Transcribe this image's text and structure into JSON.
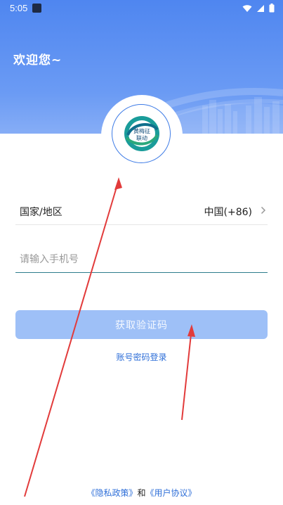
{
  "status_bar": {
    "time": "5:05"
  },
  "header": {
    "greeting": "欢迎您~"
  },
  "logo": {
    "text_line1": "黄梅征",
    "text_line2": "联动"
  },
  "country_row": {
    "label": "国家/地区",
    "value": "中国(+86)"
  },
  "phone": {
    "placeholder": "请输入手机号",
    "value": ""
  },
  "code_button": {
    "label": "获取验证码"
  },
  "password_login": {
    "label": "账号密码登录"
  },
  "footer": {
    "privacy": "《隐私政策》",
    "conj": "和",
    "terms": "《用户协议》"
  },
  "colors": {
    "header": "#5b8ff2",
    "button": "#9ec0f7",
    "link": "#2f6fd8",
    "annotation": "#e23b3b"
  }
}
